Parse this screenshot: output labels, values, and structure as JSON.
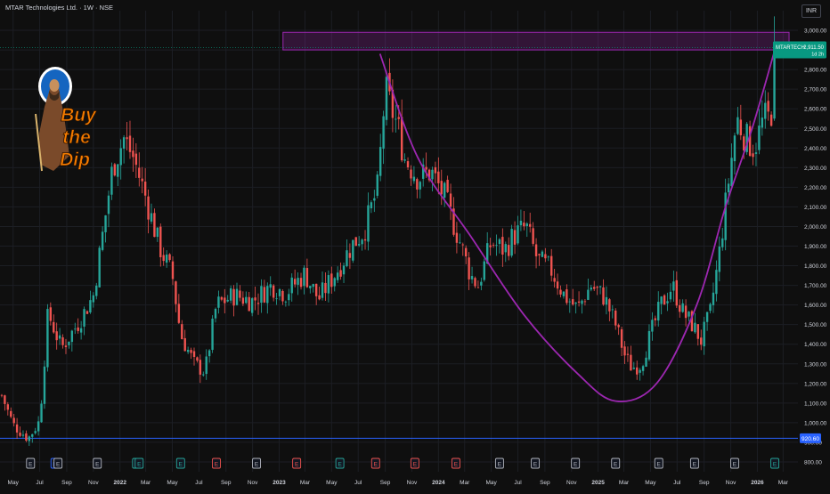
{
  "header": {
    "title": "MTAR Technologies Ltd. · 1W · NSE",
    "currency": "INR"
  },
  "price_tag": {
    "symbol": "MTARTECH",
    "price": "2,911.50",
    "countdown": "1d 2h"
  },
  "support_label": "920.60",
  "logo_text": [
    "Buy",
    "the",
    "Dip"
  ],
  "colors": {
    "up": "#26a69a",
    "down": "#ef5350",
    "curve": "#9c27b0",
    "resistance_fill": "rgba(156,39,176,0.25)",
    "support": "#2962ff",
    "price_tag": "#089981",
    "background": "#0f0f0f"
  },
  "events": [
    {
      "label": "E",
      "color": "#b2b5be",
      "date": "2021-06-10"
    },
    {
      "label": "D",
      "color": "#2962ff",
      "date": "2021-08-05"
    },
    {
      "label": "E",
      "color": "#b2b5be",
      "date": "2021-08-12"
    },
    {
      "label": "E",
      "color": "#b2b5be",
      "date": "2021-11-10"
    },
    {
      "label": "D",
      "color": "#26a69a",
      "date": "2022-02-08"
    },
    {
      "label": "E",
      "color": "#26a69a",
      "date": "2022-02-14"
    },
    {
      "label": "E",
      "color": "#26a69a",
      "date": "2022-05-20"
    },
    {
      "label": "E",
      "color": "#ef5350",
      "date": "2022-08-10"
    },
    {
      "label": "E",
      "color": "#b2b5be",
      "date": "2022-11-10"
    },
    {
      "label": "E",
      "color": "#ef5350",
      "date": "2023-02-10"
    },
    {
      "label": "E",
      "color": "#26a69a",
      "date": "2023-05-20"
    },
    {
      "label": "E",
      "color": "#ef5350",
      "date": "2023-08-10"
    },
    {
      "label": "E",
      "color": "#ef5350",
      "date": "2023-11-08"
    },
    {
      "label": "E",
      "color": "#ef5350",
      "date": "2024-02-10"
    },
    {
      "label": "E",
      "color": "#b2b5be",
      "date": "2024-05-20"
    },
    {
      "label": "E",
      "color": "#b2b5be",
      "date": "2024-08-10"
    },
    {
      "label": "E",
      "color": "#b2b5be",
      "date": "2024-11-10"
    },
    {
      "label": "E",
      "color": "#b2b5be",
      "date": "2025-02-10"
    },
    {
      "label": "E",
      "color": "#b2b5be",
      "date": "2025-05-20"
    },
    {
      "label": "E",
      "color": "#b2b5be",
      "date": "2025-08-10"
    },
    {
      "label": "E",
      "color": "#b2b5be",
      "date": "2025-11-10"
    },
    {
      "label": "E",
      "color": "#26a69a",
      "date": "2026-02-10"
    }
  ],
  "chart_data": {
    "type": "candlestick",
    "title": "MTAR Technologies Ltd. · 1W · NSE",
    "x_axis": {
      "type": "date",
      "range": [
        "2021-04-01",
        "2026-04-04"
      ],
      "ticks": [
        {
          "label": "May",
          "date": "2021-05-01"
        },
        {
          "label": "Jul",
          "date": "2021-07-01"
        },
        {
          "label": "Sep",
          "date": "2021-09-01"
        },
        {
          "label": "Nov",
          "date": "2021-11-01"
        },
        {
          "label": "2022",
          "date": "2022-01-01"
        },
        {
          "label": "Mar",
          "date": "2022-03-01"
        },
        {
          "label": "May",
          "date": "2022-05-01"
        },
        {
          "label": "Jul",
          "date": "2022-07-01"
        },
        {
          "label": "Sep",
          "date": "2022-09-01"
        },
        {
          "label": "Nov",
          "date": "2022-11-01"
        },
        {
          "label": "2023",
          "date": "2023-01-01"
        },
        {
          "label": "Mar",
          "date": "2023-03-01"
        },
        {
          "label": "May",
          "date": "2023-05-01"
        },
        {
          "label": "Jul",
          "date": "2023-07-01"
        },
        {
          "label": "Sep",
          "date": "2023-09-01"
        },
        {
          "label": "Nov",
          "date": "2023-11-01"
        },
        {
          "label": "2024",
          "date": "2024-01-01"
        },
        {
          "label": "Mar",
          "date": "2024-03-01"
        },
        {
          "label": "May",
          "date": "2024-05-01"
        },
        {
          "label": "Jul",
          "date": "2024-07-01"
        },
        {
          "label": "Sep",
          "date": "2024-09-01"
        },
        {
          "label": "Nov",
          "date": "2024-11-01"
        },
        {
          "label": "2025",
          "date": "2025-01-01"
        },
        {
          "label": "Mar",
          "date": "2025-03-01"
        },
        {
          "label": "May",
          "date": "2025-05-01"
        },
        {
          "label": "Jul",
          "date": "2025-07-01"
        },
        {
          "label": "Sep",
          "date": "2025-09-01"
        },
        {
          "label": "Nov",
          "date": "2025-11-01"
        },
        {
          "label": "2026",
          "date": "2026-01-01"
        },
        {
          "label": "Mar",
          "date": "2026-03-01"
        }
      ]
    },
    "y_axis": {
      "range": [
        750,
        3100
      ],
      "ticks": [
        "800.00",
        "900.00",
        "1,000.00",
        "1,100.00",
        "1,200.00",
        "1,300.00",
        "1,400.00",
        "1,500.00",
        "1,600.00",
        "1,700.00",
        "1,800.00",
        "1,900.00",
        "2,000.00",
        "2,100.00",
        "2,200.00",
        "2,300.00",
        "2,400.00",
        "2,500.00",
        "2,600.00",
        "2,700.00",
        "2,800.00",
        "2,900.00",
        "3,000.00"
      ]
    },
    "last_price": 2911.5,
    "support_level": 920.6,
    "resistance_zone": {
      "from_date": "2023-08-10",
      "to_date": "2026-02-10",
      "low": 2900,
      "high": 2990
    },
    "cup_curve": [
      {
        "date": "2023-08-20",
        "value": 2880
      },
      {
        "date": "2023-11-15",
        "value": 2350
      },
      {
        "date": "2024-03-15",
        "value": 1950
      },
      {
        "date": "2024-07-15",
        "value": 1550
      },
      {
        "date": "2024-11-15",
        "value": 1250
      },
      {
        "date": "2025-02-10",
        "value": 1110
      },
      {
        "date": "2025-05-15",
        "value": 1200
      },
      {
        "date": "2025-08-15",
        "value": 1600
      },
      {
        "date": "2025-10-20",
        "value": 2100
      },
      {
        "date": "2025-12-20",
        "value": 2500
      },
      {
        "date": "2026-02-10",
        "value": 2900
      }
    ],
    "price_anchors": [
      {
        "date": "2021-04-05",
        "value": 1140
      },
      {
        "date": "2021-05-01",
        "value": 990
      },
      {
        "date": "2021-06-05",
        "value": 920
      },
      {
        "date": "2021-07-01",
        "value": 1010
      },
      {
        "date": "2021-07-20",
        "value": 1560
      },
      {
        "date": "2021-08-20",
        "value": 1380
      },
      {
        "date": "2021-10-01",
        "value": 1520
      },
      {
        "date": "2021-11-01",
        "value": 1650
      },
      {
        "date": "2021-11-25",
        "value": 2000
      },
      {
        "date": "2021-12-15",
        "value": 2300
      },
      {
        "date": "2022-01-10",
        "value": 2450
      },
      {
        "date": "2022-02-01",
        "value": 2350
      },
      {
        "date": "2022-03-01",
        "value": 2150
      },
      {
        "date": "2022-04-01",
        "value": 1900
      },
      {
        "date": "2022-05-01",
        "value": 1750
      },
      {
        "date": "2022-05-20",
        "value": 1450
      },
      {
        "date": "2022-06-20",
        "value": 1300
      },
      {
        "date": "2022-07-15",
        "value": 1260
      },
      {
        "date": "2022-08-10",
        "value": 1600
      },
      {
        "date": "2022-09-20",
        "value": 1650
      },
      {
        "date": "2022-11-01",
        "value": 1620
      },
      {
        "date": "2022-12-15",
        "value": 1700
      },
      {
        "date": "2023-01-15",
        "value": 1660
      },
      {
        "date": "2023-03-01",
        "value": 1760
      },
      {
        "date": "2023-04-01",
        "value": 1630
      },
      {
        "date": "2023-05-15",
        "value": 1780
      },
      {
        "date": "2023-06-15",
        "value": 1900
      },
      {
        "date": "2023-07-15",
        "value": 1980
      },
      {
        "date": "2023-08-15",
        "value": 2200
      },
      {
        "date": "2023-09-01",
        "value": 2700
      },
      {
        "date": "2023-09-15",
        "value": 2600
      },
      {
        "date": "2023-10-01",
        "value": 2500
      },
      {
        "date": "2023-10-15",
        "value": 2350
      },
      {
        "date": "2023-11-15",
        "value": 2250
      },
      {
        "date": "2023-12-15",
        "value": 2280
      },
      {
        "date": "2024-01-15",
        "value": 2150
      },
      {
        "date": "2024-02-15",
        "value": 1950
      },
      {
        "date": "2024-03-15",
        "value": 1750
      },
      {
        "date": "2024-04-01",
        "value": 1700
      },
      {
        "date": "2024-05-01",
        "value": 1920
      },
      {
        "date": "2024-06-01",
        "value": 1880
      },
      {
        "date": "2024-06-20",
        "value": 1950
      },
      {
        "date": "2024-07-20",
        "value": 2000
      },
      {
        "date": "2024-08-15",
        "value": 1830
      },
      {
        "date": "2024-09-15",
        "value": 1780
      },
      {
        "date": "2024-10-15",
        "value": 1650
      },
      {
        "date": "2024-11-15",
        "value": 1580
      },
      {
        "date": "2024-12-15",
        "value": 1700
      },
      {
        "date": "2025-01-15",
        "value": 1640
      },
      {
        "date": "2025-02-10",
        "value": 1500
      },
      {
        "date": "2025-03-05",
        "value": 1330
      },
      {
        "date": "2025-03-20",
        "value": 1280
      },
      {
        "date": "2025-04-10",
        "value": 1300
      },
      {
        "date": "2025-05-01",
        "value": 1450
      },
      {
        "date": "2025-05-25",
        "value": 1600
      },
      {
        "date": "2025-06-20",
        "value": 1700
      },
      {
        "date": "2025-07-15",
        "value": 1560
      },
      {
        "date": "2025-08-05",
        "value": 1500
      },
      {
        "date": "2025-08-25",
        "value": 1420
      },
      {
        "date": "2025-09-15",
        "value": 1560
      },
      {
        "date": "2025-10-05",
        "value": 1850
      },
      {
        "date": "2025-10-25",
        "value": 2200
      },
      {
        "date": "2025-11-15",
        "value": 2550
      },
      {
        "date": "2025-12-05",
        "value": 2450
      },
      {
        "date": "2025-12-25",
        "value": 2400
      },
      {
        "date": "2026-01-15",
        "value": 2550
      },
      {
        "date": "2026-02-01",
        "value": 2550
      },
      {
        "date": "2026-02-10",
        "value": 2911.5
      }
    ]
  }
}
